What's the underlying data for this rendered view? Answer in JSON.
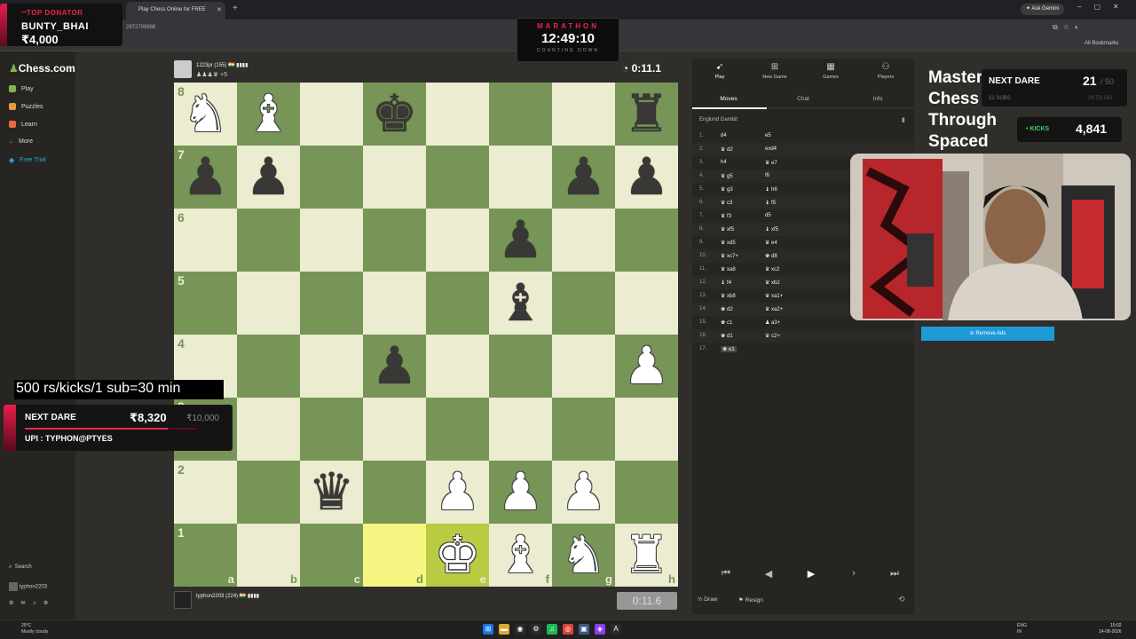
{
  "browser": {
    "tab_title": "Play Chess Online for FREE",
    "url_fragment": "2972709668",
    "gemini_label": "Ask Gemini",
    "all_bookmarks": "All Bookmarks"
  },
  "sidebar": {
    "logo": "Chess.com",
    "items": [
      {
        "label": "Play",
        "color": "#81b64c"
      },
      {
        "label": "Puzzles",
        "color": "#e89a3c"
      },
      {
        "label": "Learn",
        "color": "#e66a3c"
      },
      {
        "label": "More",
        "color": "#999999"
      },
      {
        "label": "Free Trial",
        "color": "#27a5de"
      }
    ],
    "search_label": "Search",
    "username": "typhon2203",
    "notif_count": "1"
  },
  "overlays": {
    "top_donator_label": "TOP DONATOR",
    "top_donator_name": "BUNTY_BHAI",
    "top_donator_amount": "₹4,000",
    "marathon_title": "MARATHON",
    "marathon_time": "12:49:10",
    "marathon_sub": "COUNTING DOWN",
    "rate_note": "500 rs/kicks/1 sub=30 min",
    "next_dare_label": "NEXT DARE",
    "next_dare_amount": "₹8,320",
    "next_dare_max": "₹10,000",
    "next_dare_progress": 0.832,
    "upi": "UPI : TYPHON@PTYES",
    "master_text": "Master\nChess\nThrough\nSpaced",
    "subs_dare_label": "NEXT DARE",
    "subs_dare_value": "21",
    "subs_dare_max": "/ 50",
    "subs_count": "21 SUBS",
    "subs_count_right": "29 TO GO",
    "kicks_label": "• KICKS",
    "kicks_value": "4,841",
    "remove_ads": "Remove Ads"
  },
  "game": {
    "top_player": {
      "name": "1223pr (155) 🇮🇳 ▮▮▮▮",
      "captured": "♟♟♟♛ +5",
      "clock": "0:11.1"
    },
    "bottom_player": {
      "name": "typhon2203 (224) 🇮🇳 ▮▮▮▮",
      "captured": "",
      "clock": "0:11.6"
    },
    "files": [
      "a",
      "b",
      "c",
      "d",
      "e",
      "f",
      "g",
      "h"
    ],
    "ranks": [
      "8",
      "7",
      "6",
      "5",
      "4",
      "3",
      "2",
      "1"
    ],
    "highlights": [
      "d1",
      "e1"
    ],
    "pieces": [
      {
        "sq": "a8",
        "c": "w",
        "p": "♞"
      },
      {
        "sq": "b8",
        "c": "w",
        "p": "♝"
      },
      {
        "sq": "d8",
        "c": "b",
        "p": "♚"
      },
      {
        "sq": "h8",
        "c": "b",
        "p": "♜"
      },
      {
        "sq": "a7",
        "c": "b",
        "p": "♟"
      },
      {
        "sq": "b7",
        "c": "b",
        "p": "♟"
      },
      {
        "sq": "g7",
        "c": "b",
        "p": "♟"
      },
      {
        "sq": "h7",
        "c": "b",
        "p": "♟"
      },
      {
        "sq": "f6",
        "c": "b",
        "p": "♟"
      },
      {
        "sq": "f5",
        "c": "b",
        "p": "♝"
      },
      {
        "sq": "d4",
        "c": "b",
        "p": "♟"
      },
      {
        "sq": "h4",
        "c": "w",
        "p": "♟"
      },
      {
        "sq": "a3",
        "c": "b",
        "p": "♟"
      },
      {
        "sq": "c2",
        "c": "b",
        "p": "♛"
      },
      {
        "sq": "e2",
        "c": "w",
        "p": "♟"
      },
      {
        "sq": "f2",
        "c": "w",
        "p": "♟"
      },
      {
        "sq": "g2",
        "c": "w",
        "p": "♟"
      },
      {
        "sq": "e1",
        "c": "w",
        "p": "♚"
      },
      {
        "sq": "f1",
        "c": "w",
        "p": "♝"
      },
      {
        "sq": "g1",
        "c": "w",
        "p": "♞"
      },
      {
        "sq": "h1",
        "c": "w",
        "p": "♜"
      }
    ]
  },
  "panel": {
    "tabs": [
      "Play",
      "New Game",
      "Games",
      "Players"
    ],
    "subtabs": [
      "Moves",
      "Chat",
      "Info"
    ],
    "opening": "Englund Gambit",
    "moves": [
      {
        "n": "1.",
        "w": "d4",
        "b": "e5"
      },
      {
        "n": "2.",
        "w": "♛ d2",
        "b": "exd4"
      },
      {
        "n": "3.",
        "w": "h4",
        "b": "♛ e7"
      },
      {
        "n": "4.",
        "w": "♛ g5",
        "b": "f6"
      },
      {
        "n": "5.",
        "w": "♛ g3",
        "b": "♝ h6"
      },
      {
        "n": "6.",
        "w": "♛ c3",
        "b": "♝ f5"
      },
      {
        "n": "7.",
        "w": "♛ f3",
        "b": "d5"
      },
      {
        "n": "8.",
        "w": "♛ xf5",
        "b": "♝ xf5"
      },
      {
        "n": "9.",
        "w": "♛ xd5",
        "b": "♛ e4"
      },
      {
        "n": "10.",
        "w": "♛ xc7+",
        "b": "♚ d8"
      },
      {
        "n": "11.",
        "w": "♛ xa8",
        "b": "♛ xc2"
      },
      {
        "n": "12.",
        "w": "♝ f4",
        "b": "♛ xb2"
      },
      {
        "n": "13.",
        "w": "♛ xb8",
        "b": "♛ xa1+"
      },
      {
        "n": "14.",
        "w": "♚ d2",
        "b": "♛ xa2+"
      },
      {
        "n": "15.",
        "w": "♚ c1",
        "b": "♟ a3+"
      },
      {
        "n": "16.",
        "w": "♚ d1",
        "b": "♛ c2+"
      },
      {
        "n": "17.",
        "w": "♚ e1",
        "b": ""
      }
    ],
    "draw_label": "Draw",
    "resign_label": "Resign"
  },
  "taskbar": {
    "weather_temp": "29°C",
    "weather_desc": "Mostly cloudy",
    "lang": "ENG",
    "lang2": "IN",
    "time": "15:02",
    "date": "14-08-2026"
  }
}
